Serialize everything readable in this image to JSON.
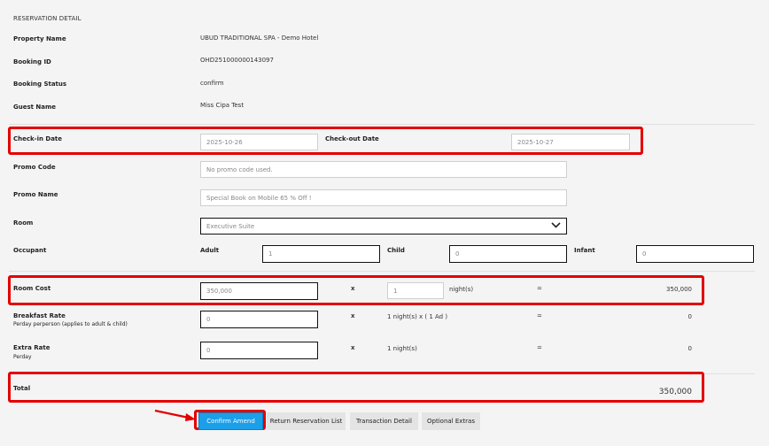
{
  "section_title": "RESERVATION DETAIL",
  "details": {
    "property_name_label": "Property Name",
    "property_name_value": "UBUD TRADITIONAL SPA - Demo Hotel",
    "booking_id_label": "Booking ID",
    "booking_id_value": "OHD251000000143097",
    "booking_status_label": "Booking Status",
    "booking_status_value": "confirm",
    "guest_name_label": "Guest Name",
    "guest_name_value": "Miss Cipa Test"
  },
  "dates": {
    "checkin_label": "Check-in Date",
    "checkin_value": "2025-10-26",
    "checkout_label": "Check-out Date",
    "checkout_value": "2025-10-27"
  },
  "promo": {
    "code_label": "Promo Code",
    "code_value": "No promo code used.",
    "name_label": "Promo Name",
    "name_value": "Special Book on Mobile 65 % Off !"
  },
  "room": {
    "label": "Room",
    "selected": "Executive Suite"
  },
  "occupant": {
    "label": "Occupant",
    "adult_label": "Adult",
    "adult_value": "1",
    "child_label": "Child",
    "child_value": "0",
    "infant_label": "Infant",
    "infant_value": "0"
  },
  "room_cost": {
    "label": "Room Cost",
    "value": "350,000",
    "x": "x",
    "nights_value": "1",
    "nights_label": "night(s)",
    "eq": "=",
    "result": "350,000"
  },
  "breakfast": {
    "label": "Breakfast Rate",
    "sublabel": "Perday perperson (applies to adult & child)",
    "value": "0",
    "x": "x",
    "desc": "1 night(s) x ( 1 Ad )",
    "eq": "=",
    "result": "0"
  },
  "extra": {
    "label": "Extra Rate",
    "sublabel": "Perday",
    "value": "0",
    "x": "x",
    "desc": "1 night(s)",
    "eq": "=",
    "result": "0"
  },
  "total": {
    "label": "Total",
    "value": "350,000"
  },
  "buttons": {
    "confirm": "Confirm Amend",
    "return": "Return Reservation List",
    "transaction": "Transaction Detail",
    "extras": "Optional Extras"
  },
  "icons": {
    "dropdown": "chevron-down-icon",
    "pointer": "red-arrow-icon"
  },
  "colors": {
    "highlight": "#e30000",
    "primary_button": "#1a9fe8"
  }
}
